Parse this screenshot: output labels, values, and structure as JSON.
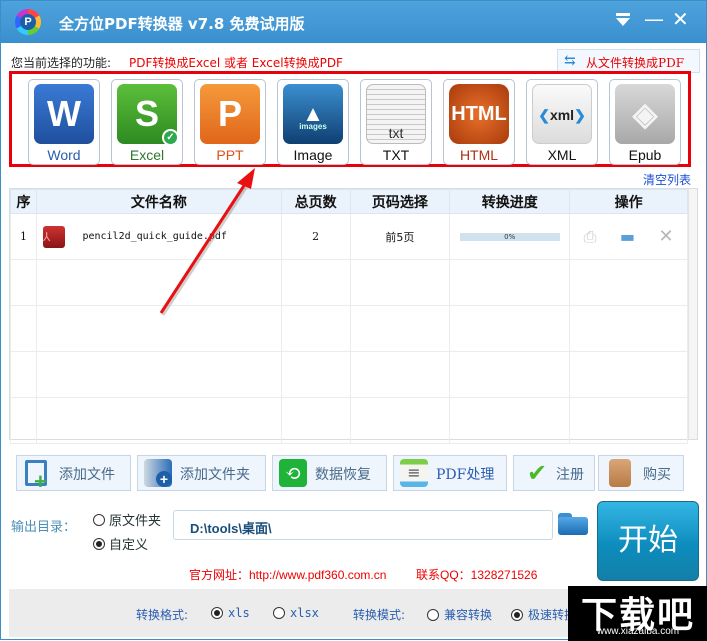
{
  "window": {
    "title": "全方位PDF转换器 v7.8 免费试用版",
    "controls": [
      "menu",
      "minimize",
      "close"
    ]
  },
  "function_bar": {
    "label": "您当前选择的功能:",
    "current": "PDF转换成Excel 或者 Excel转换成PDF",
    "from_file_button": "从文件转换成PDF"
  },
  "formats": [
    {
      "id": "word",
      "label": "Word",
      "icon": "W",
      "color": "#2b63b8",
      "label_color": "#2a5db0",
      "selected": false
    },
    {
      "id": "excel",
      "label": "Excel",
      "icon": "S",
      "color": "#3d9b2f",
      "label_color": "#2d7a2a",
      "selected": true
    },
    {
      "id": "ppt",
      "label": "PPT",
      "icon": "P",
      "color": "#e8731f",
      "label_color": "#e0501a",
      "selected": false
    },
    {
      "id": "image",
      "label": "Image",
      "icon": "images",
      "color": "#1a5f96",
      "label_color": "#111",
      "selected": false
    },
    {
      "id": "txt",
      "label": "TXT",
      "icon": "txt",
      "color": "#e8e8e8",
      "label_color": "#111",
      "selected": false
    },
    {
      "id": "html",
      "label": "HTML",
      "icon": "HTML",
      "color": "#c64a12",
      "label_color": "#b03010",
      "selected": false
    },
    {
      "id": "xml",
      "label": "XML",
      "icon": "<xml>",
      "color": "#f0f0f0",
      "label_color": "#111",
      "selected": false
    },
    {
      "id": "epub",
      "label": "Epub",
      "icon": "e",
      "color": "#b8b8b8",
      "label_color": "#111",
      "selected": false
    }
  ],
  "clear_list": "清空列表",
  "table": {
    "headers": [
      "序",
      "文件名称",
      "总页数",
      "页码选择",
      "转换进度",
      "操作"
    ],
    "rows": [
      {
        "index": "1",
        "file_name": "pencil2d_quick_guide.pdf",
        "total_pages": "2",
        "page_selection": "前5页",
        "progress_text": "0%",
        "progress": 0
      }
    ],
    "empty_rows": 4
  },
  "toolbar": {
    "add_file": "添加文件",
    "add_folder": "添加文件夹",
    "data_recovery": "数据恢复",
    "pdf_process": "PDF处理",
    "register": "注册",
    "buy": "购买"
  },
  "output": {
    "label": "输出目录：",
    "option_original": "原文件夹",
    "option_custom": "自定义",
    "selected": "custom",
    "path": "D:\\tools\\桌面\\"
  },
  "start_button": "开始",
  "contact": {
    "site": "官方网址：http://www.pdf360.com.cn",
    "qq": "联系QQ：1328271526"
  },
  "options": {
    "format_label": "转换格式:",
    "format_xls": "xls",
    "format_xlsx": "xlsx",
    "format_selected": "xls",
    "mode_label": "转换模式:",
    "mode_compat": "兼容转换",
    "mode_fast": "极速转换",
    "mode_selected": "fast"
  },
  "watermark": {
    "text": "下载吧",
    "url": "www.xiazaiba.com"
  }
}
